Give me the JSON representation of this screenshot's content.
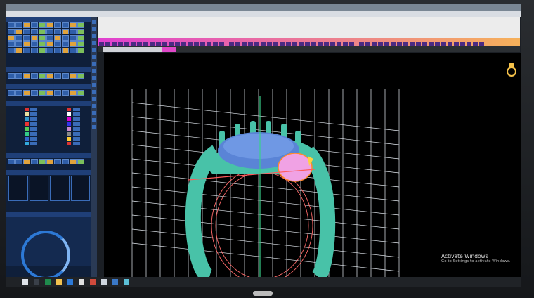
{
  "desktop": {
    "activation_title": "Activate Windows",
    "activation_sub": "Go to Settings to activate Windows."
  },
  "colors": {
    "ring": "#48c2a8",
    "gem": "#5a84d6",
    "accent_magenta": "#e040d0",
    "grid": "#e8eef5"
  },
  "icons": [
    "search-icon",
    "file-explorer-icon",
    "excel-icon",
    "app-icon",
    "app-icon",
    "app-icon",
    "photos-icon",
    "app-icon",
    "app-icon"
  ]
}
